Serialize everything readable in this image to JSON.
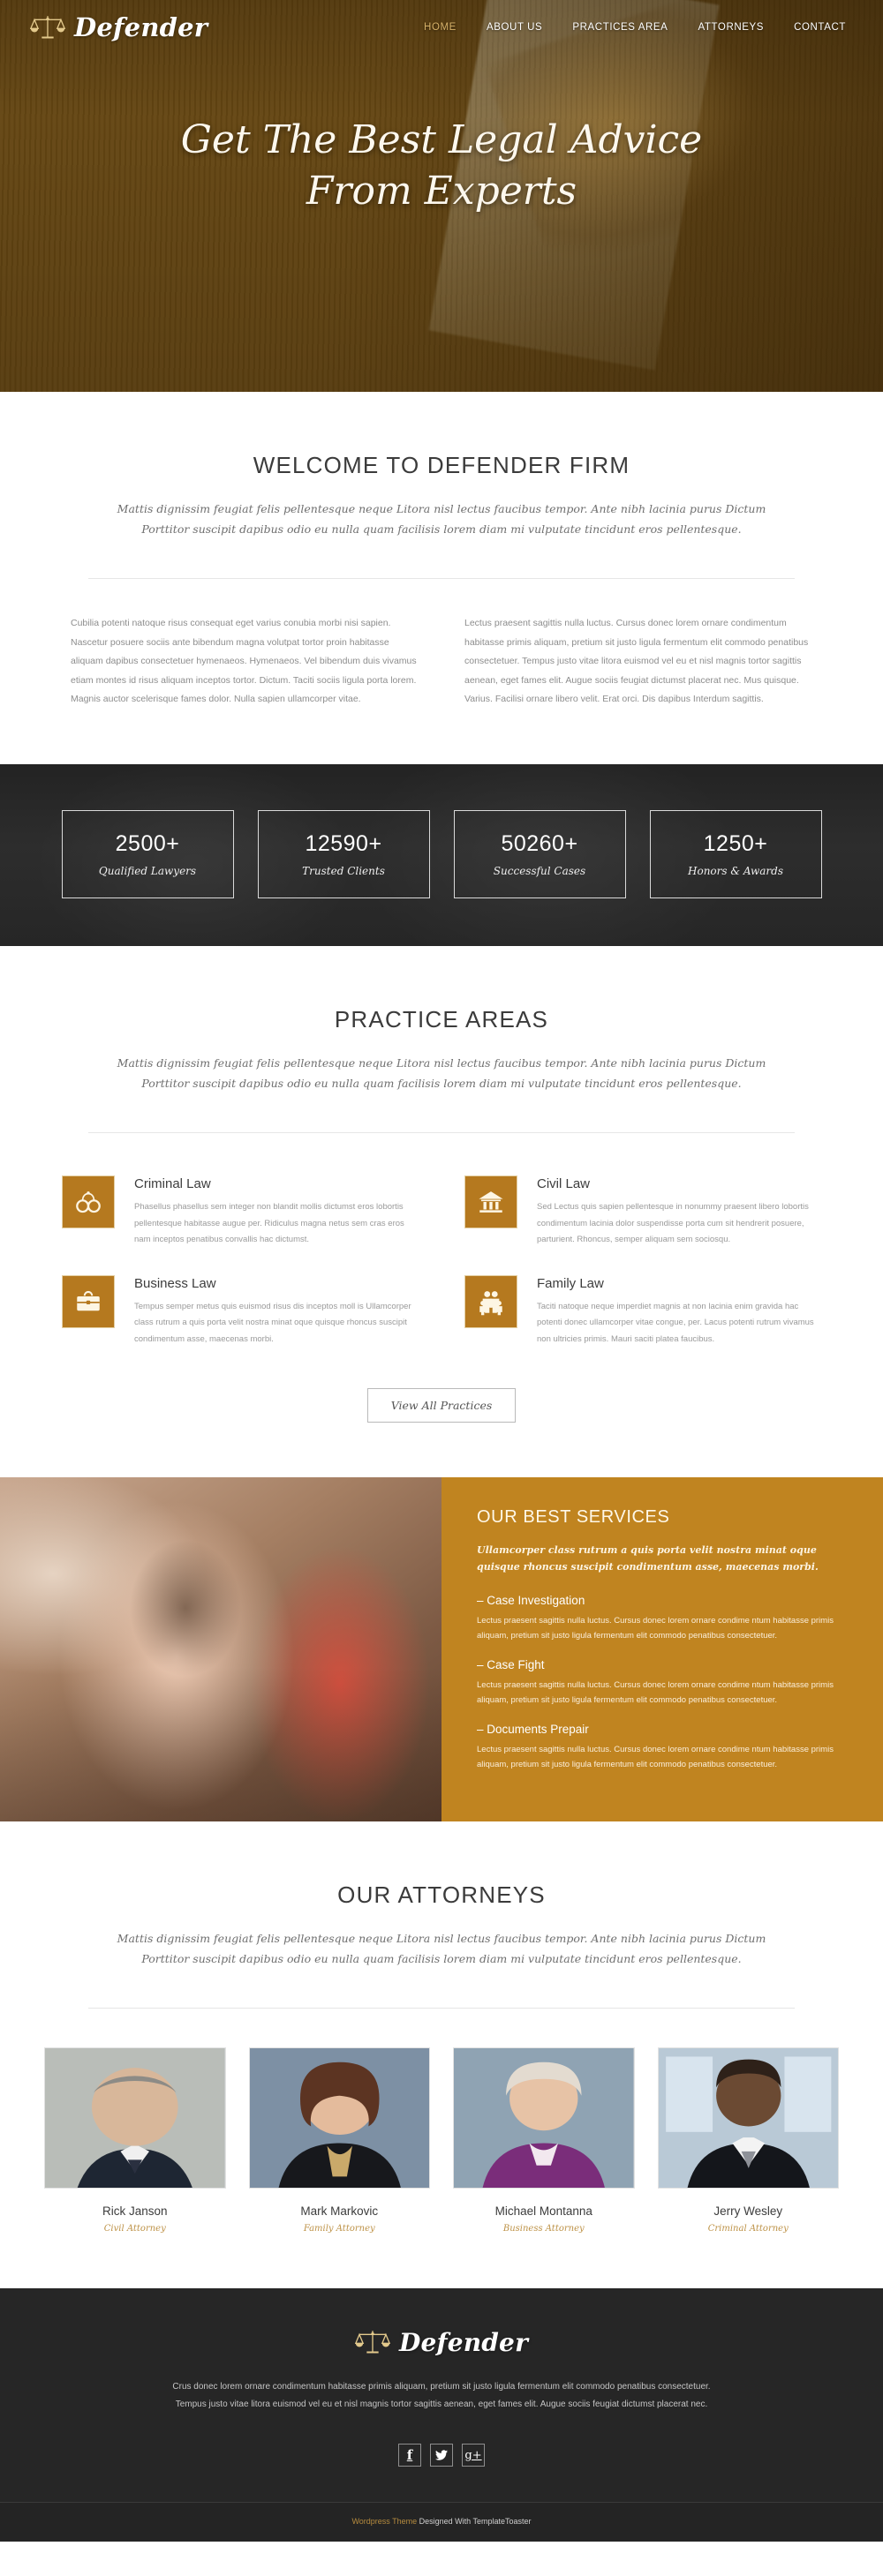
{
  "brand": {
    "name": "Defender",
    "logo_icon": "scales-of-justice-icon"
  },
  "nav": {
    "items": [
      {
        "label": "HOME",
        "active": true
      },
      {
        "label": "ABOUT US",
        "active": false
      },
      {
        "label": "PRACTICES AREA",
        "active": false
      },
      {
        "label": "ATTORNEYS",
        "active": false
      },
      {
        "label": "CONTACT",
        "active": false
      }
    ]
  },
  "hero": {
    "line1": "Get The Best Legal Advice",
    "line2": "From Experts"
  },
  "welcome": {
    "title": "WELCOME TO DEFENDER FIRM",
    "subtitle": "Mattis dignissim feugiat felis pellentesque neque Litora nisl lectus faucibus tempor. Ante nibh lacinia purus Dictum Porttitor suscipit dapibus odio eu nulla quam facilisis lorem diam mi vulputate tincidunt eros pellentesque.",
    "col1": "Cubilia potenti natoque risus consequat eget varius conubia morbi nisi sapien. Nascetur posuere sociis ante bibendum magna volutpat tortor proin habitasse aliquam dapibus consectetuer hymenaeos. Hymenaeos. Vel bibendum duis vivamus etiam montes id risus aliquam inceptos tortor. Dictum. Taciti sociis ligula porta lorem. Magnis auctor scelerisque fames dolor. Nulla sapien ullamcorper vitae.",
    "col2": "Lectus praesent sagittis nulla luctus. Cursus donec lorem ornare condimentum habitasse primis aliquam, pretium sit justo ligula fermentum elit commodo penatibus consectetuer. Tempus justo vitae litora euismod vel eu et nisl magnis tortor sagittis aenean, eget fames elit. Augue sociis feugiat dictumst placerat nec. Mus quisque. Varius. Facilisi ornare libero velit. Erat orci. Dis dapibus Interdum sagittis."
  },
  "stats": [
    {
      "number": "2500+",
      "label": "Qualified Lawyers"
    },
    {
      "number": "12590+",
      "label": "Trusted Clients"
    },
    {
      "number": "50260+",
      "label": "Successful Cases"
    },
    {
      "number": "1250+",
      "label": "Honors & Awards"
    }
  ],
  "practice": {
    "title": "PRACTICE AREAS",
    "subtitle": "Mattis dignissim feugiat felis pellentesque neque Litora nisl lectus faucibus tempor. Ante nibh lacinia purus Dictum Porttitor suscipit dapibus odio eu nulla quam facilisis lorem diam mi vulputate tincidunt eros pellentesque.",
    "cards": [
      {
        "icon": "handcuffs-icon",
        "title": "Criminal Law",
        "text": "Phasellus phasellus sem integer non blandit mollis dictumst eros lobortis pellentesque habitasse augue per. Ridiculus magna netus sem cras eros nam inceptos penatibus convallis hac dictumst."
      },
      {
        "icon": "courthouse-icon",
        "title": "Civil Law",
        "text": "Sed Lectus quis sapien pellentesque in nonummy praesent libero lobortis condimentum lacinia dolor suspendisse porta cum sit hendrerit posuere, parturient. Rhoncus, semper aliquam sem sociosqu."
      },
      {
        "icon": "briefcase-icon",
        "title": "Business Law",
        "text": "Tempus semper metus quis euismod risus dis inceptos moll is Ullamcorper class rutrum a quis porta velit nostra minat oque quisque rhoncus suscipit condimentum asse, maecenas morbi."
      },
      {
        "icon": "family-icon",
        "title": "Family Law",
        "text": "Taciti natoque neque imperdiet magnis at non lacinia enim gravida hac potenti donec ullamcorper vitae congue, per. Lacus potenti rutrum vivamus non ultricies primis. Mauri saciti platea faucibus."
      }
    ],
    "button_label": "View All Practices"
  },
  "services": {
    "title": "OUR BEST SERVICES",
    "lead": "Ullamcorper class rutrum a quis porta velit nostra minat oque quisque rhoncus suscipit condimentum asse, maecenas morbi.",
    "items": [
      {
        "title": "– Case Investigation",
        "text": "Lectus praesent sagittis nulla luctus. Cursus donec lorem ornare condime ntum habitasse primis aliquam, pretium sit justo ligula fermentum elit commodo penatibus consectetuer."
      },
      {
        "title": "– Case Fight",
        "text": "Lectus praesent sagittis nulla luctus. Cursus donec lorem ornare condime ntum habitasse primis aliquam, pretium sit justo ligula fermentum elit commodo penatibus consectetuer."
      },
      {
        "title": "– Documents Prepair",
        "text": "Lectus praesent sagittis nulla luctus. Cursus donec lorem ornare condime ntum habitasse primis aliquam, pretium sit justo ligula fermentum elit commodo penatibus consectetuer."
      }
    ]
  },
  "attorneys": {
    "title": "OUR ATTORNEYS",
    "subtitle": "Mattis dignissim feugiat felis pellentesque neque Litora nisl lectus faucibus tempor. Ante nibh lacinia purus Dictum Porttitor suscipit dapibus odio eu nulla quam facilisis lorem diam mi vulputate tincidunt eros pellentesque.",
    "people": [
      {
        "name": "Rick Janson",
        "role": "Civil Attorney"
      },
      {
        "name": "Mark Markovic",
        "role": "Family Attorney"
      },
      {
        "name": "Michael Montanna",
        "role": "Business Attorney"
      },
      {
        "name": "Jerry Wesley",
        "role": "Criminal Attorney"
      }
    ]
  },
  "footer": {
    "brand": "Defender",
    "text": "Crus donec lorem ornare condimentum habitasse primis aliquam, pretium sit justo ligula fermentum elit commodo penatibus consectetuer. Tempus justo vitae litora euismod vel eu et nisl magnis tortor sagittis aenean, eget fames elit. Augue sociis feugiat dictumst placerat nec.",
    "socials": [
      {
        "icon": "facebook-icon",
        "glyph": "f"
      },
      {
        "icon": "twitter-icon",
        "glyph": "twitter-bird"
      },
      {
        "icon": "google-plus-icon",
        "glyph": "g+"
      }
    ],
    "credit_gold": "Wordpress Theme",
    "credit_rest": " Designed With TemplateToaster"
  },
  "colors": {
    "accent_gold": "#b5791f",
    "services_bg": "#c08420",
    "dark": "#262626",
    "nav_active": "#d6b168"
  }
}
